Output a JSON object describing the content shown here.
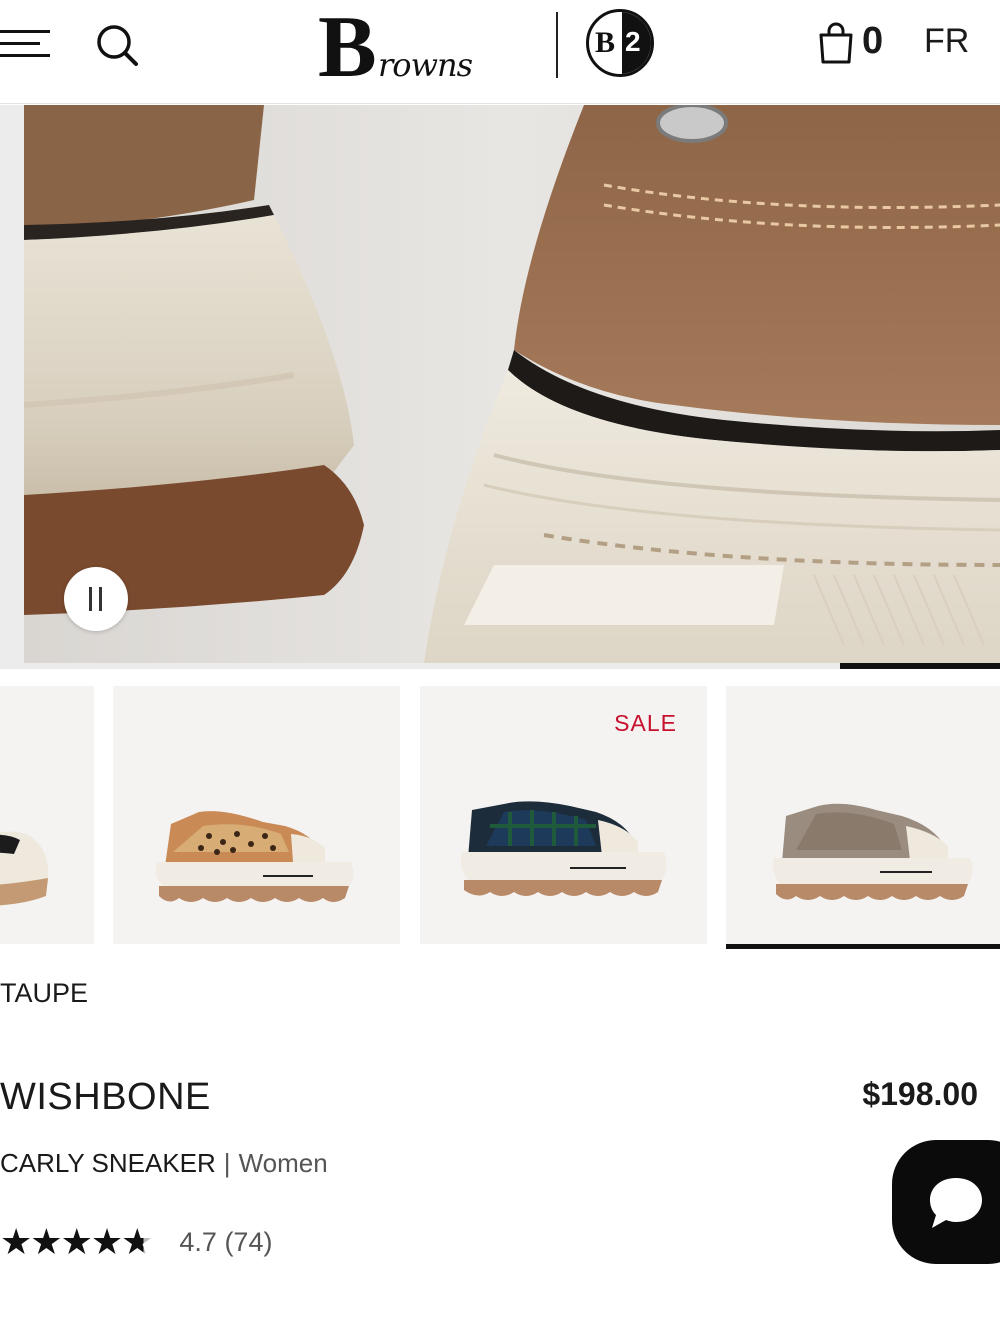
{
  "header": {
    "logo_initial": "B",
    "logo_text": "rowns",
    "b2_left": "B",
    "b2_right": "2",
    "cart_count": "0",
    "language": "FR",
    "icons": [
      "menu-icon",
      "search-icon",
      "shopping-bag-icon"
    ]
  },
  "hero": {
    "pause_icon": "pause-icon",
    "slide_progress": 0.16
  },
  "thumbnails": [
    {
      "name": "partial-white-sneaker",
      "badge": "",
      "selected": false
    },
    {
      "name": "leopard-sneaker",
      "badge": "",
      "selected": false
    },
    {
      "name": "plaid-sneaker",
      "badge": "SALE",
      "selected": false
    },
    {
      "name": "taupe-sneaker",
      "badge": "",
      "selected": true
    }
  ],
  "product": {
    "color": "TAUPE",
    "brand": "WISHBONE",
    "price": "$198.00",
    "name": "CARLY SNEAKER",
    "separator": "|",
    "gender": "Women",
    "rating_value": "4.7",
    "review_count": "(74)",
    "rating_text": "4.7 (74)",
    "stars_filled": 4.7,
    "stars_total": 5
  },
  "chat": {
    "icon": "chat-bubble-icon"
  },
  "colors": {
    "sale_red": "#c8102e",
    "chat_black": "#0b0b0b",
    "text": "#1a1a1a"
  }
}
